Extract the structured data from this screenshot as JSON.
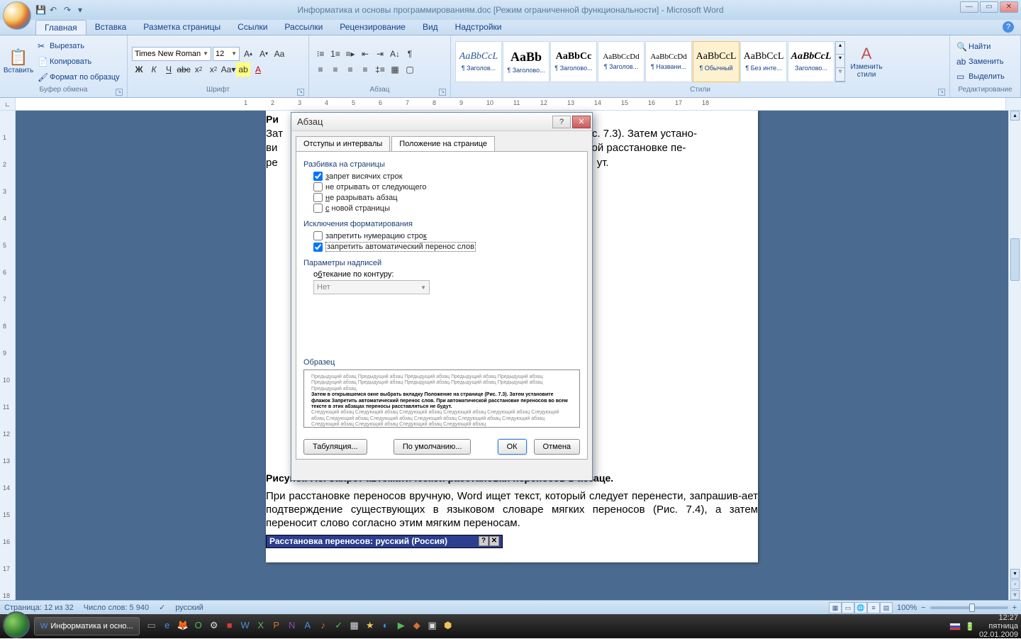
{
  "titlebar": {
    "title": "Информатика и основы программированиям.doc [Режим ограниченной функциональности] - Microsoft Word"
  },
  "tabs": {
    "items": [
      "Главная",
      "Вставка",
      "Разметка страницы",
      "Ссылки",
      "Рассылки",
      "Рецензирование",
      "Вид",
      "Надстройки"
    ],
    "active_index": 0
  },
  "ribbon": {
    "clipboard": {
      "label": "Буфер обмена",
      "paste": "Вставить",
      "cut": "Вырезать",
      "copy": "Копировать",
      "format_painter": "Формат по образцу"
    },
    "font": {
      "label": "Шрифт",
      "font_name": "Times New Roman",
      "font_size": "12"
    },
    "paragraph": {
      "label": "Абзац"
    },
    "styles": {
      "label": "Стили",
      "items": [
        {
          "preview": "AaBbCcL",
          "name": "¶ Заголов..."
        },
        {
          "preview": "AaBb",
          "name": "¶ Заголово..."
        },
        {
          "preview": "AaBbCc",
          "name": "¶ Заголово..."
        },
        {
          "preview": "AaBbCcDd",
          "name": "¶ Заголов..."
        },
        {
          "preview": "AaBbCcDd",
          "name": "¶ Названи..."
        },
        {
          "preview": "AaBbCcL",
          "name": "¶ Обычный"
        },
        {
          "preview": "AaBbCcL",
          "name": "¶ Без инте..."
        },
        {
          "preview": "AaBbCcL",
          "name": "Заголово..."
        }
      ],
      "selected_index": 5,
      "change": "Изменить стили"
    },
    "editing": {
      "label": "Редактирование",
      "find": "Найти",
      "replace": "Заменить",
      "select": "Выделить"
    }
  },
  "document": {
    "fragment_top": "(Рис. 7.3). Затем устано-",
    "fragment_mid": "тической расстановке пе-",
    "fragment_end": "ут.",
    "caption": "Рисунок 7.3. Запрет автоматической расстановки переносов в абзаце.",
    "para": "При расстановке переносов вручную, Word ищет текст, который следует перенести, запрашив-ает подтверждение существующих в языковом словаре мягких переносов (Рис. 7.4), а затем переносит слово согласно этим мягким переносам.",
    "embedded_dialog": "Расстановка переносов: русский (Россия)"
  },
  "dialog": {
    "title": "Абзац",
    "tabs": [
      "Отступы и интервалы",
      "Положение на странице"
    ],
    "active_tab": 1,
    "section_pagination": "Разбивка на страницы",
    "cb_widow": "запрет висячих строк",
    "cb_keep_next": "не отрывать от следующего",
    "cb_keep_together": "не разрывать абзац",
    "cb_page_break": "с новой страницы",
    "section_format_exceptions": "Исключения форматирования",
    "cb_suppress_numbers": "запретить нумерацию строк",
    "cb_suppress_hyphen": "запретить автоматический перенос слов",
    "section_textbox": "Параметры надписей",
    "wrap_label": "обтекание по контуру:",
    "wrap_value": "Нет",
    "preview_label": "Образец",
    "preview_grey": "Предыдущий абзац Предыдущий абзац Предыдущий абзац Предыдущий абзац Предыдущий абзац Предыдущий абзац Предыдущий абзац Предыдущий абзац Предыдущий абзац Предыдущий абзац Предыдущий абзац",
    "preview_dark": "Затем в открывшемся окне выбрать вкладку Положение на странице (Рис. 7.3). Затем установите флажок Запретить автоматический перенос слов. При автоматической расстановке переносов во всем тексте в этих абзацах переносы расставляться не будут.",
    "preview_grey2": "Следующий абзац Следующий абзац Следующий абзац Следующий абзац Следующий абзац Следующий абзац Следующий абзац Следующий абзац Следующий абзац Следующий абзац Следующий абзац Следующий абзац Следующий абзац Следующий абзац Следующий абзац",
    "btn_tabs": "Табуляция...",
    "btn_default": "По умолчанию...",
    "btn_ok": "ОК",
    "btn_cancel": "Отмена"
  },
  "statusbar": {
    "page": "Страница: 12 из 32",
    "words": "Число слов: 5 940",
    "lang": "русский",
    "zoom": "100%"
  },
  "taskbar": {
    "app": "Информатика и осно...",
    "time": "12:27",
    "date": "02.01.2009",
    "day": "пятница"
  }
}
